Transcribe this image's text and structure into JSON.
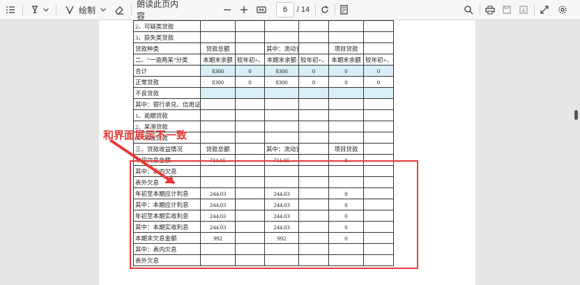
{
  "toolbar": {
    "draw_label": "绘制",
    "read_aloud_label": "朗读此页内容",
    "current_page": "6",
    "page_total": "/ 14",
    "icons": [
      "contents-icon",
      "highlight-icon",
      "chevron-down-icon",
      "draw-icon",
      "chevron-down-icon",
      "eraser-icon",
      "zoom-out-icon",
      "zoom-in-icon",
      "fit-page-icon",
      "rotate-icon",
      "page-view-icon",
      "search-icon",
      "print-icon",
      "save-icon",
      "save-as-icon",
      "fullscreen-icon",
      "settings-icon"
    ]
  },
  "annotation": {
    "text": "和界面展示不一致",
    "color": "#e53935"
  },
  "table": {
    "rows": [
      [
        "  2、可疑类贷款",
        "",
        "",
        "",
        "",
        "",
        ""
      ],
      [
        "  3、损失类贷款",
        "",
        "",
        "",
        "",
        "",
        ""
      ],
      [
        "贷款种类",
        "贷款总额",
        "",
        "其中：流动资金",
        "",
        "项目贷款",
        ""
      ],
      [
        "二、“一逾两呆”分类",
        "本期末余额",
        "较年初+、-额",
        "本期末余额",
        "较年初+、-额",
        "本期末余额",
        "较年初+、-额"
      ],
      [
        "合计",
        "8300",
        "0",
        "8300",
        "0",
        "0",
        "0"
      ],
      [
        "正常贷款",
        "8300",
        "0",
        "8300",
        "0",
        "0",
        "0"
      ],
      [
        "不良贷款",
        "",
        "",
        "",
        "",
        "",
        ""
      ],
      [
        "其中：银行承兑、信用证、保函垫付额",
        "",
        "",
        "",
        "",
        "",
        ""
      ],
      [
        "  1、逾期贷款",
        "",
        "",
        "",
        "",
        "",
        ""
      ],
      [
        "  2、呆滞贷款",
        "",
        "",
        "",
        "",
        "",
        ""
      ],
      [
        "  3、呆帐贷款",
        "",
        "",
        "",
        "",
        "",
        ""
      ],
      [
        "三、贷款收益情况",
        "贷款总额",
        "",
        "其中：流动资金",
        "",
        "项目贷款",
        ""
      ],
      [
        "年初欠息金额",
        "711.65",
        "",
        "711.65",
        "",
        "0",
        ""
      ],
      [
        "  其中：表内欠息",
        "",
        "",
        "",
        "",
        "",
        ""
      ],
      [
        "  表外欠息",
        "",
        "",
        "",
        "",
        "",
        ""
      ],
      [
        "年初至本期应计利息",
        "244.03",
        "",
        "244.03",
        "",
        "0",
        ""
      ],
      [
        "  其中：本期应计利息",
        "244.03",
        "",
        "244.03",
        "",
        "0",
        ""
      ],
      [
        "年初至本期实收利息",
        "244.03",
        "",
        "244.03",
        "",
        "0",
        ""
      ],
      [
        "  其中：本期实收利息",
        "244.03",
        "",
        "244.03",
        "",
        "0",
        ""
      ],
      [
        "本期末欠息金额",
        "992",
        "",
        "992",
        "",
        "0",
        ""
      ],
      [
        "  其中：表内欠息",
        "",
        "",
        "",
        "",
        "",
        ""
      ],
      [
        "表外欠息",
        "",
        "",
        "",
        "",
        "",
        ""
      ]
    ]
  }
}
